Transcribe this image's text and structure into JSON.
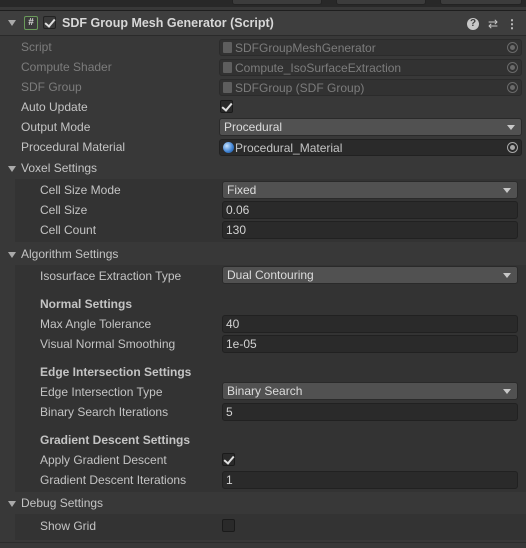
{
  "header": {
    "title": "SDF Group Mesh Generator (Script)",
    "enabled": true,
    "icons": [
      "help-icon",
      "preset-icon",
      "more-icon"
    ]
  },
  "fields": {
    "script": {
      "label": "Script",
      "value": "SDFGroupMeshGenerator"
    },
    "compute_shader": {
      "label": "Compute Shader",
      "value": "Compute_IsoSurfaceExtraction"
    },
    "sdf_group": {
      "label": "SDF Group",
      "value": "SDFGroup (SDF Group)"
    },
    "auto_update": {
      "label": "Auto Update",
      "checked": true
    },
    "output_mode": {
      "label": "Output Mode",
      "value": "Procedural"
    },
    "procedural_material": {
      "label": "Procedural Material",
      "value": "Procedural_Material"
    }
  },
  "voxel": {
    "title": "Voxel Settings",
    "cell_size_mode": {
      "label": "Cell Size Mode",
      "value": "Fixed"
    },
    "cell_size": {
      "label": "Cell Size",
      "value": "0.06"
    },
    "cell_count": {
      "label": "Cell Count",
      "value": "130"
    }
  },
  "algorithm": {
    "title": "Algorithm Settings",
    "iso_type": {
      "label": "Isosurface Extraction Type",
      "value": "Dual Contouring"
    },
    "normal_header": "Normal Settings",
    "max_angle": {
      "label": "Max Angle Tolerance",
      "value": "40"
    },
    "visual_smoothing": {
      "label": "Visual Normal Smoothing",
      "value": "1e-05"
    },
    "edge_header": "Edge Intersection Settings",
    "edge_type": {
      "label": "Edge Intersection Type",
      "value": "Binary Search"
    },
    "binary_iters": {
      "label": "Binary Search Iterations",
      "value": "5"
    },
    "gradient_header": "Gradient Descent Settings",
    "apply_gradient": {
      "label": "Apply Gradient Descent",
      "checked": true
    },
    "gradient_iters": {
      "label": "Gradient Descent Iterations",
      "value": "1"
    }
  },
  "debug": {
    "title": "Debug Settings",
    "show_grid": {
      "label": "Show Grid",
      "checked": false
    }
  },
  "colors": {
    "background": "#383838",
    "field": "#2a2a2a",
    "dropdown": "#515151",
    "text": "#c4c4c4",
    "disabled_text": "#7c7c7c"
  }
}
